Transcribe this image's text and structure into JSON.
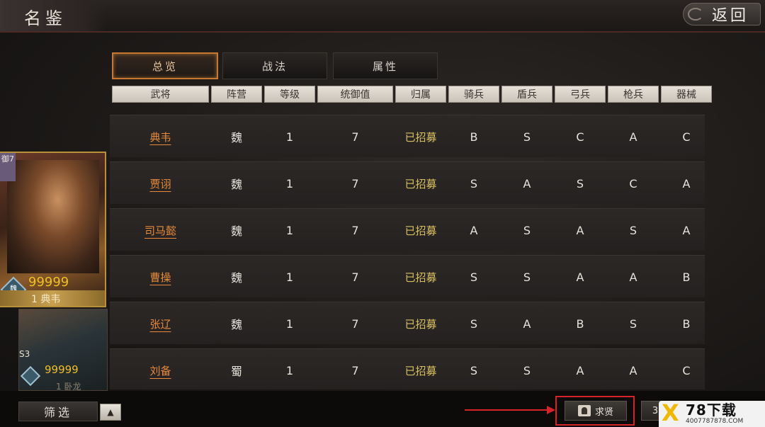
{
  "header": {
    "title": "名鉴",
    "back_label": "返回"
  },
  "tabs": [
    {
      "label": "总览",
      "active": true
    },
    {
      "label": "战法",
      "active": false
    },
    {
      "label": "属性",
      "active": false
    }
  ],
  "table": {
    "columns": [
      "武将",
      "阵营",
      "等级",
      "统御值",
      "归属",
      "骑兵",
      "盾兵",
      "弓兵",
      "枪兵",
      "器械"
    ],
    "rows": [
      {
        "name": "典韦",
        "faction": "魏",
        "level": "1",
        "command": "7",
        "status": "已招募",
        "cavalry": "B",
        "shield": "S",
        "archer": "C",
        "spear": "A",
        "siege": "C"
      },
      {
        "name": "贾诩",
        "faction": "魏",
        "level": "1",
        "command": "7",
        "status": "已招募",
        "cavalry": "S",
        "shield": "A",
        "archer": "S",
        "spear": "C",
        "siege": "A"
      },
      {
        "name": "司马懿",
        "faction": "魏",
        "level": "1",
        "command": "7",
        "status": "已招募",
        "cavalry": "A",
        "shield": "S",
        "archer": "A",
        "spear": "S",
        "siege": "A"
      },
      {
        "name": "曹操",
        "faction": "魏",
        "level": "1",
        "command": "7",
        "status": "已招募",
        "cavalry": "S",
        "shield": "S",
        "archer": "A",
        "spear": "A",
        "siege": "B"
      },
      {
        "name": "张辽",
        "faction": "魏",
        "level": "1",
        "command": "7",
        "status": "已招募",
        "cavalry": "S",
        "shield": "A",
        "archer": "B",
        "spear": "S",
        "siege": "B"
      },
      {
        "name": "刘备",
        "faction": "蜀",
        "level": "1",
        "command": "7",
        "status": "已招募",
        "cavalry": "S",
        "shield": "S",
        "archer": "A",
        "spear": "A",
        "siege": "C"
      }
    ]
  },
  "cards": [
    {
      "crest": "御7",
      "faction_badge": "魏",
      "stars": "99999",
      "name": "1 典韦"
    },
    {
      "season_badge": "S3",
      "stars": "99999",
      "name": "1 卧龙"
    }
  ],
  "bottom": {
    "filter_label": "筛选",
    "up_icon": "▲",
    "seek_label": "求贤",
    "partial_label": "3"
  },
  "watermark": {
    "main": "78下载",
    "sub": "4007787878.COM"
  },
  "colors": {
    "accent": "#e88a3a",
    "status": "#d8c060",
    "highlight": "#d8222a"
  }
}
